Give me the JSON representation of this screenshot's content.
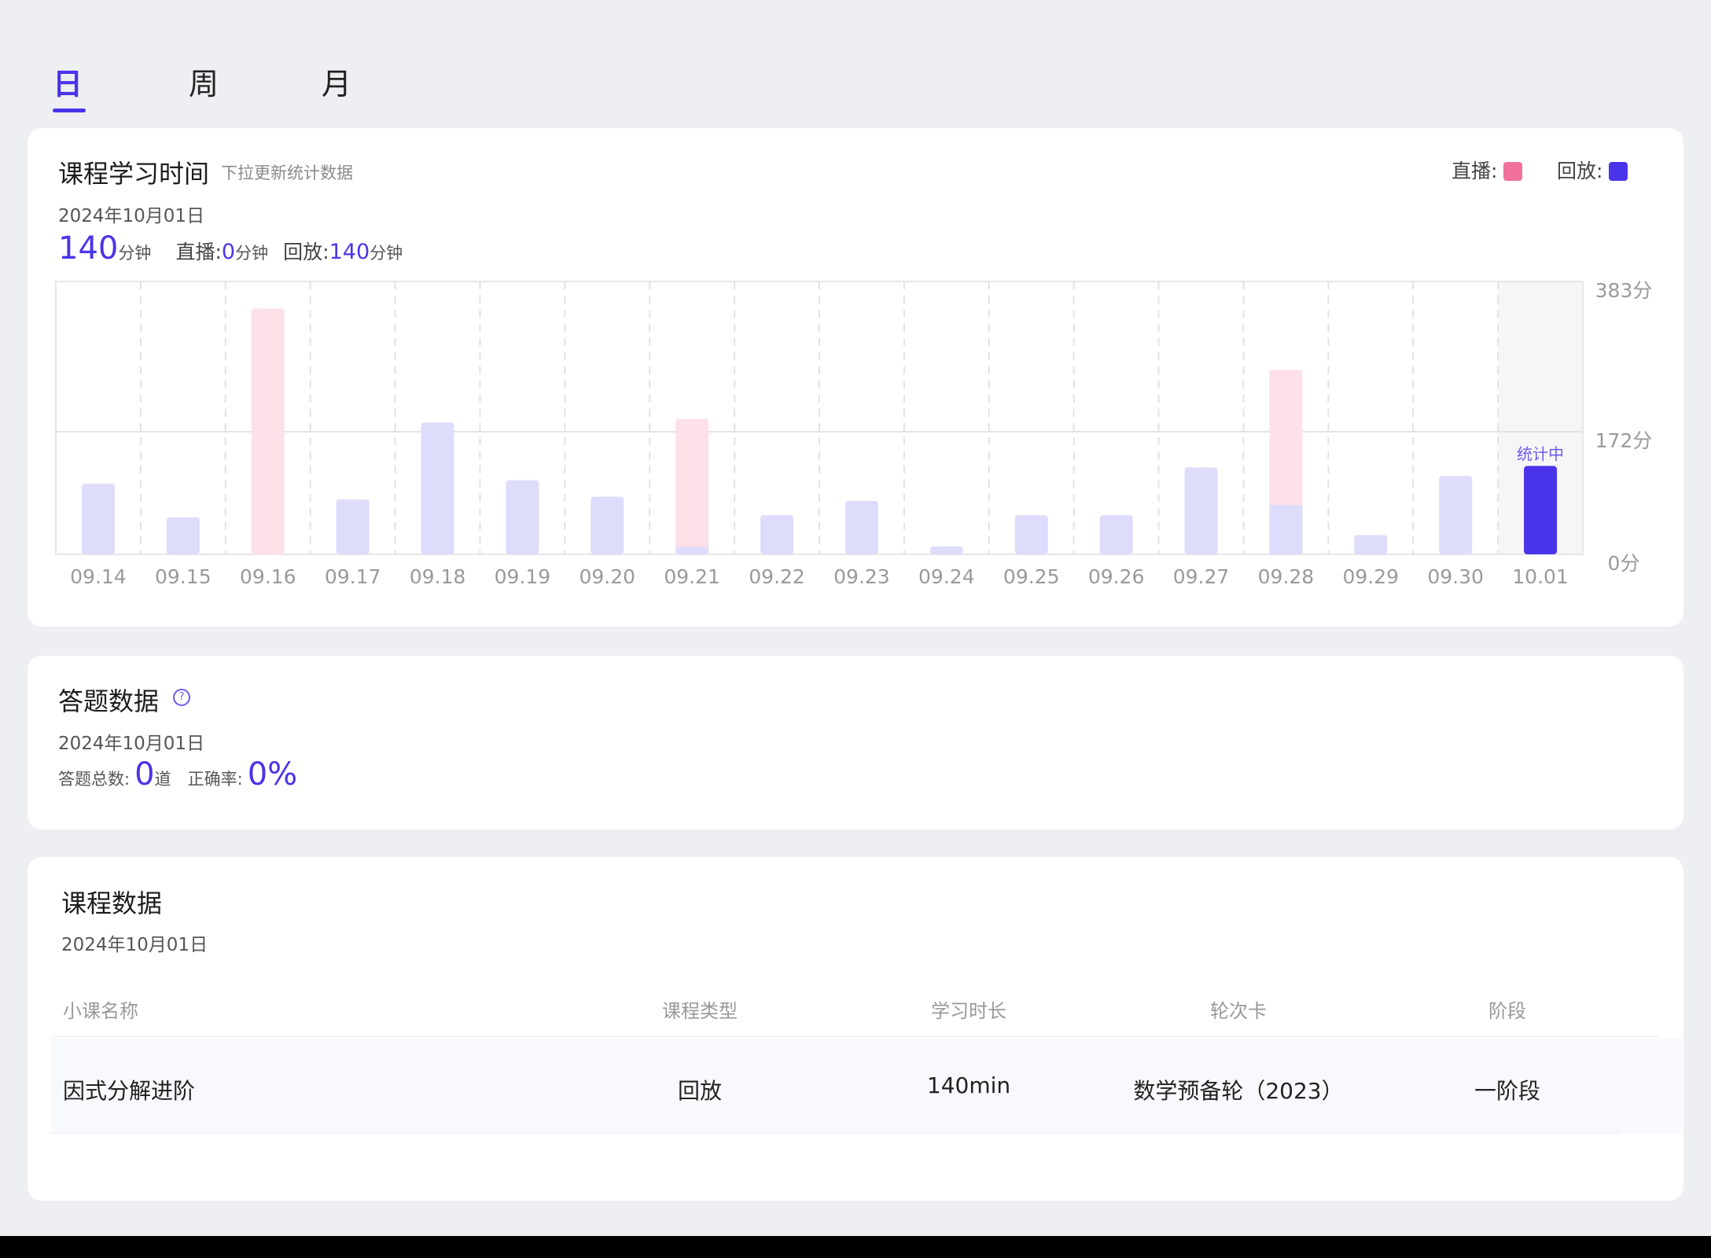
{
  "tabs": [
    {
      "label": "日",
      "active": true
    },
    {
      "label": "周",
      "active": false
    },
    {
      "label": "月",
      "active": false
    }
  ],
  "study_time": {
    "title": "课程学习时间",
    "hint": "下拉更新统计数据",
    "legend_live_label": "直播:",
    "legend_replay_label": "回放:",
    "date": "2024年10月01日",
    "total_value": "140",
    "unit": "分钟",
    "live_label": "直播:",
    "live_value": "0",
    "replay_label": "回放:",
    "replay_value": "140",
    "colors": {
      "live": "#f2719a",
      "live_light": "#fde0e8",
      "replay": "#4a34ea",
      "replay_light": "#dedcfb"
    }
  },
  "chart_data": {
    "type": "bar",
    "categories": [
      "09.14",
      "09.15",
      "09.16",
      "09.17",
      "09.18",
      "09.19",
      "09.20",
      "09.21",
      "09.22",
      "09.23",
      "09.24",
      "09.25",
      "09.26",
      "09.27",
      "09.28",
      "09.29",
      "09.30",
      "10.01"
    ],
    "series": [
      {
        "name": "回放",
        "values": [
          99,
          52,
          0,
          77,
          185,
          104,
          81,
          10,
          55,
          75,
          11,
          55,
          55,
          122,
          69,
          27,
          110,
          124
        ]
      },
      {
        "name": "直播",
        "values": [
          0,
          0,
          345,
          0,
          0,
          0,
          0,
          180,
          0,
          0,
          0,
          0,
          0,
          0,
          190,
          0,
          0,
          0
        ]
      }
    ],
    "stacked": true,
    "y_ticks": [
      "383分",
      "172分",
      "0分"
    ],
    "ylim": [
      0,
      383
    ],
    "current_label": "统计中",
    "current_category": "10.01"
  },
  "answer": {
    "title": "答题数据",
    "date": "2024年10月01日",
    "total_label": "答题总数:",
    "total_value": "0",
    "total_unit": "道",
    "accuracy_label": "正确率:",
    "accuracy_value": "0%"
  },
  "course": {
    "title": "课程数据",
    "date": "2024年10月01日",
    "headers": [
      "小课名称",
      "课程类型",
      "学习时长",
      "轮次卡",
      "阶段"
    ],
    "rows": [
      [
        "因式分解进阶",
        "回放",
        "140min",
        "数学预备轮（2023）",
        "一阶段"
      ]
    ]
  }
}
